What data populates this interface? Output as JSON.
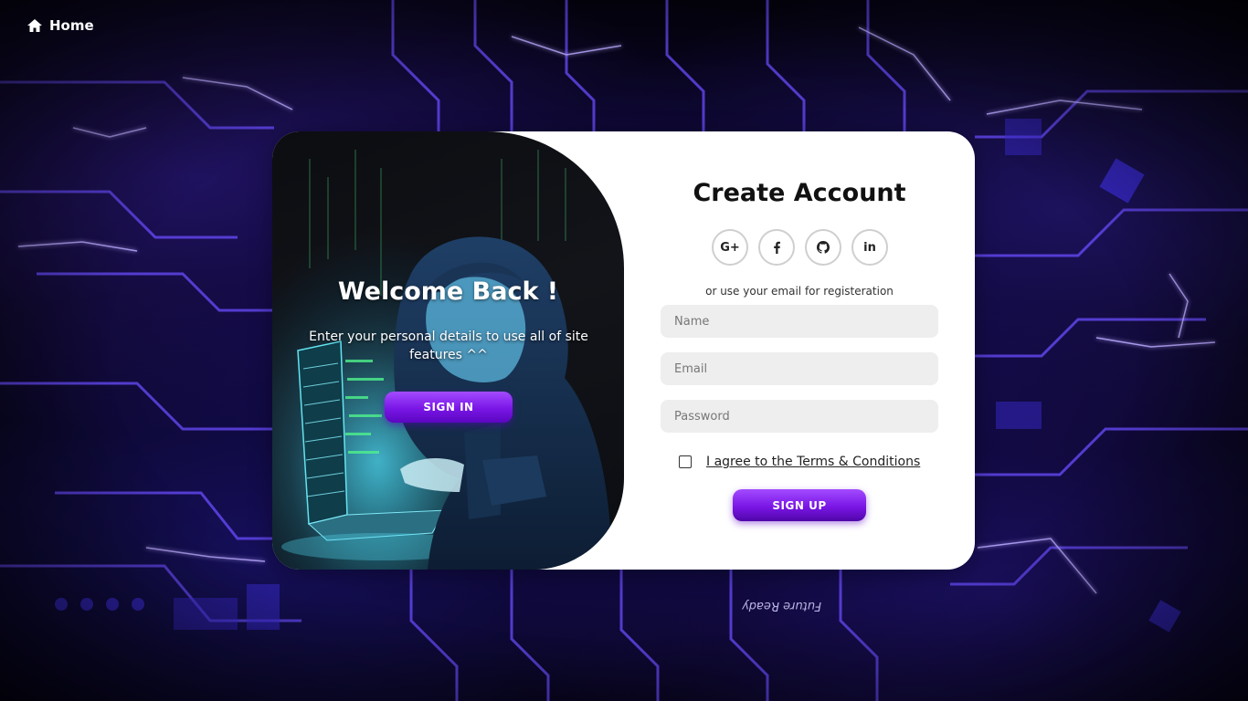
{
  "nav": {
    "home_label": "Home",
    "home_icon": "home-icon"
  },
  "welcome": {
    "title": "Welcome Back !",
    "message": "Enter your personal details to use all of site features ^^",
    "signin_label": "SIGN IN"
  },
  "register": {
    "title": "Create Account",
    "social": [
      {
        "name": "google-icon",
        "label": "G+"
      },
      {
        "name": "facebook-icon",
        "label": "f"
      },
      {
        "name": "github-icon",
        "label": ""
      },
      {
        "name": "linkedin-icon",
        "label": "in"
      }
    ],
    "or_text": "or use your email for registeration",
    "fields": {
      "name": {
        "placeholder": "Name",
        "value": ""
      },
      "email": {
        "placeholder": "Email",
        "value": ""
      },
      "password": {
        "placeholder": "Password",
        "value": ""
      }
    },
    "terms_label": "I agree to the Terms & Conditions",
    "terms_checked": false,
    "signup_label": "SIGN UP"
  },
  "background": {
    "stamp_text": "Future Ready"
  },
  "colors": {
    "accent": "#7a16e6",
    "accent_light": "#a34bff",
    "card_bg": "#ffffff",
    "field_bg": "#eeeeee",
    "page_bg": "#05030f"
  }
}
